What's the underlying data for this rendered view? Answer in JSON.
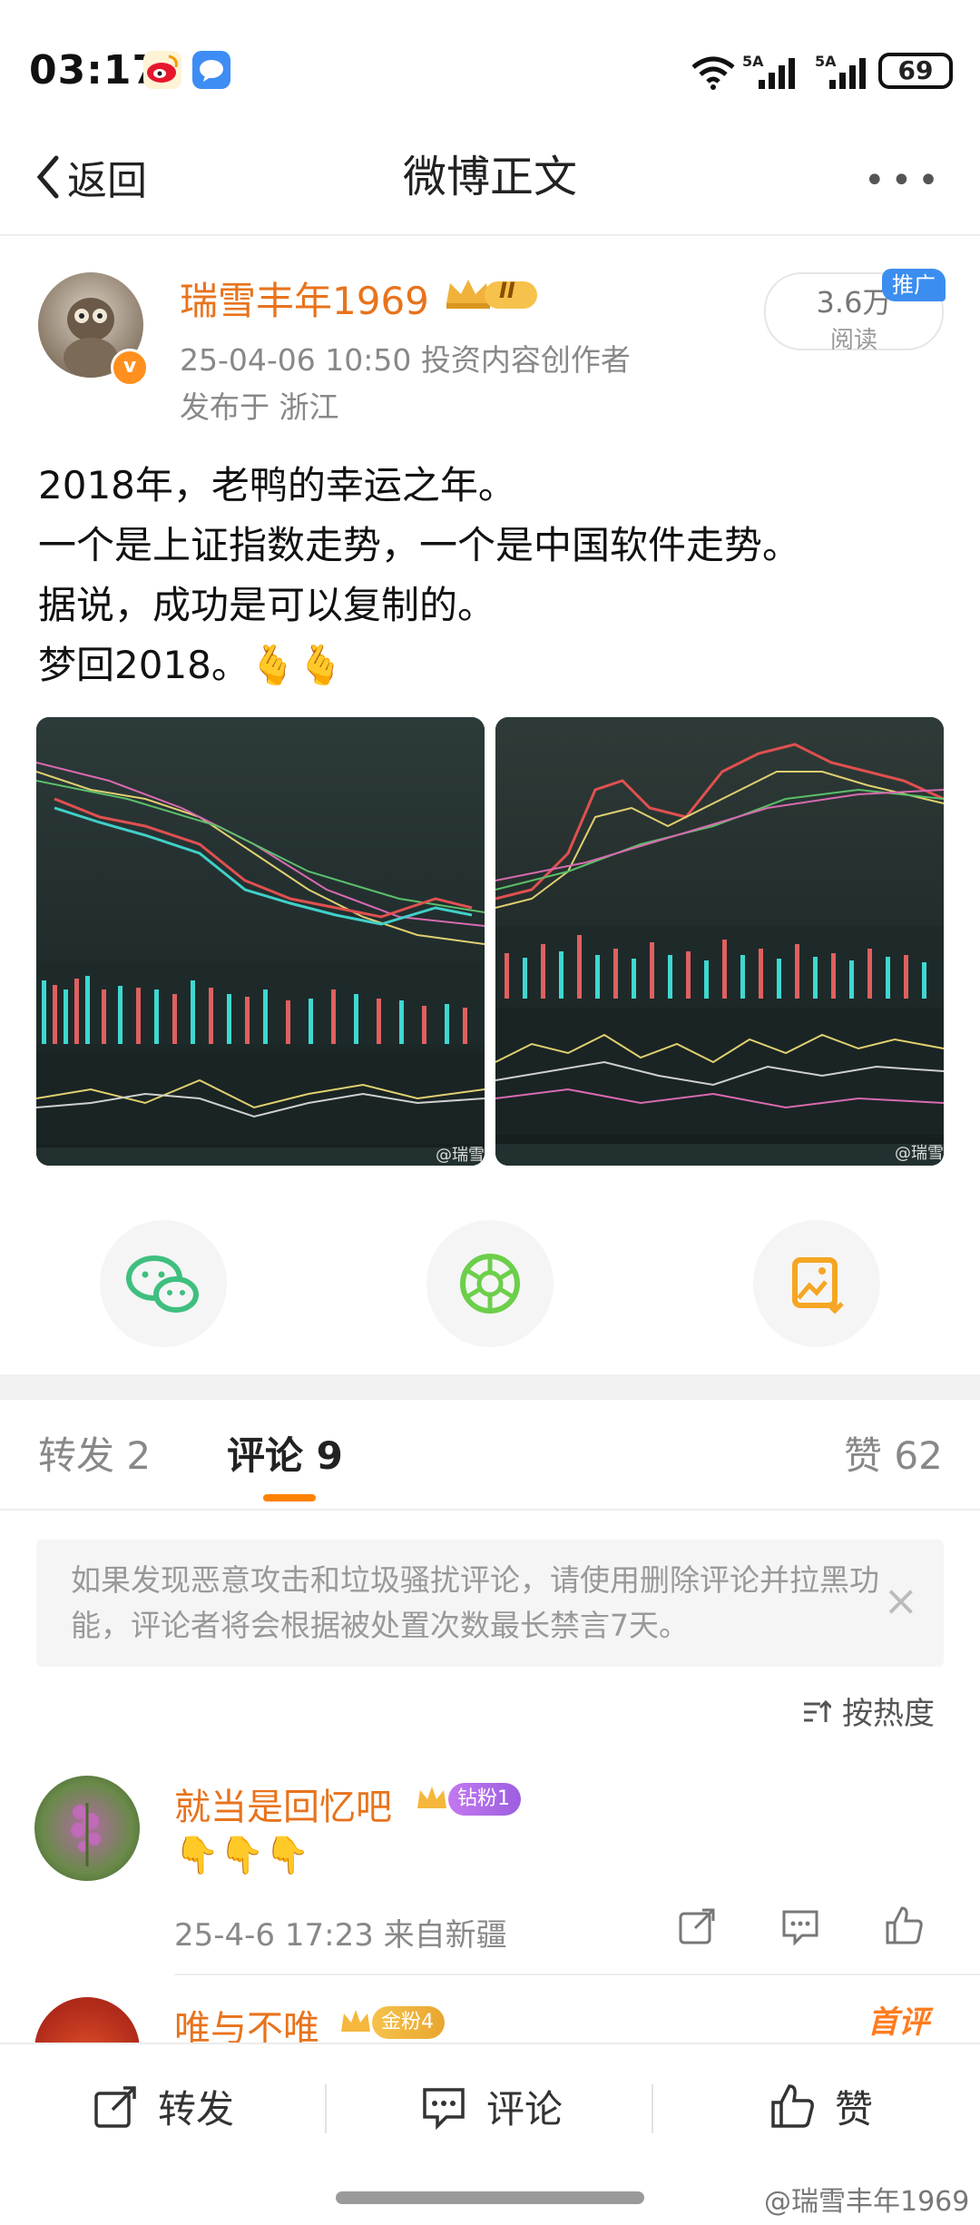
{
  "status_bar": {
    "time": "03:17",
    "signal1": "5A",
    "signal2": "5A",
    "battery": "69"
  },
  "nav": {
    "back_label": "返回",
    "title": "微博正文",
    "more": "•••"
  },
  "post": {
    "author": "瑞雪丰年1969",
    "level_badge": "II",
    "date_line": "25-04-06 10:50  投资内容创作者",
    "location": "发布于 浙江",
    "reads": "3.6万",
    "reads_label": "阅读",
    "promo": "推广",
    "lines": [
      "2018年，老鸭的幸运之年。",
      "一个是上证指数走势，一个是中国软件走势。",
      "据说，成功是可以复制的。",
      "梦回2018。🫰🫰"
    ],
    "image_watermark_1": "@瑞雪",
    "image_watermark_2": "@瑞雪"
  },
  "share": {
    "icons": [
      "wechat-icon",
      "moments-icon",
      "save-image-icon"
    ]
  },
  "tabs": {
    "repost": "转发 2",
    "comments": "评论 9",
    "likes": "赞 62"
  },
  "notice": {
    "text": "如果发现恶意攻击和垃圾骚扰评论，请使用删除评论并拉黑功能，评论者将会根据被处置次数最长禁言7天。",
    "close": "×"
  },
  "sort": {
    "label": "按热度"
  },
  "comments": [
    {
      "name": "就当是回忆吧",
      "badge": "钻粉1",
      "body": "👇👇👇",
      "meta": "25-4-6 17:23 来自新疆"
    },
    {
      "name": "唯与不唯",
      "badge": "金粉4",
      "first_tag": "首评"
    }
  ],
  "bottom_bar": {
    "repost": "转发",
    "comment": "评论",
    "like": "赞"
  },
  "page_watermark": "@瑞雪丰年1969",
  "colors": {
    "accent": "#ff8200",
    "username": "#e8731c",
    "promo": "#3b8ef0",
    "wechat": "#3fbf7f"
  }
}
